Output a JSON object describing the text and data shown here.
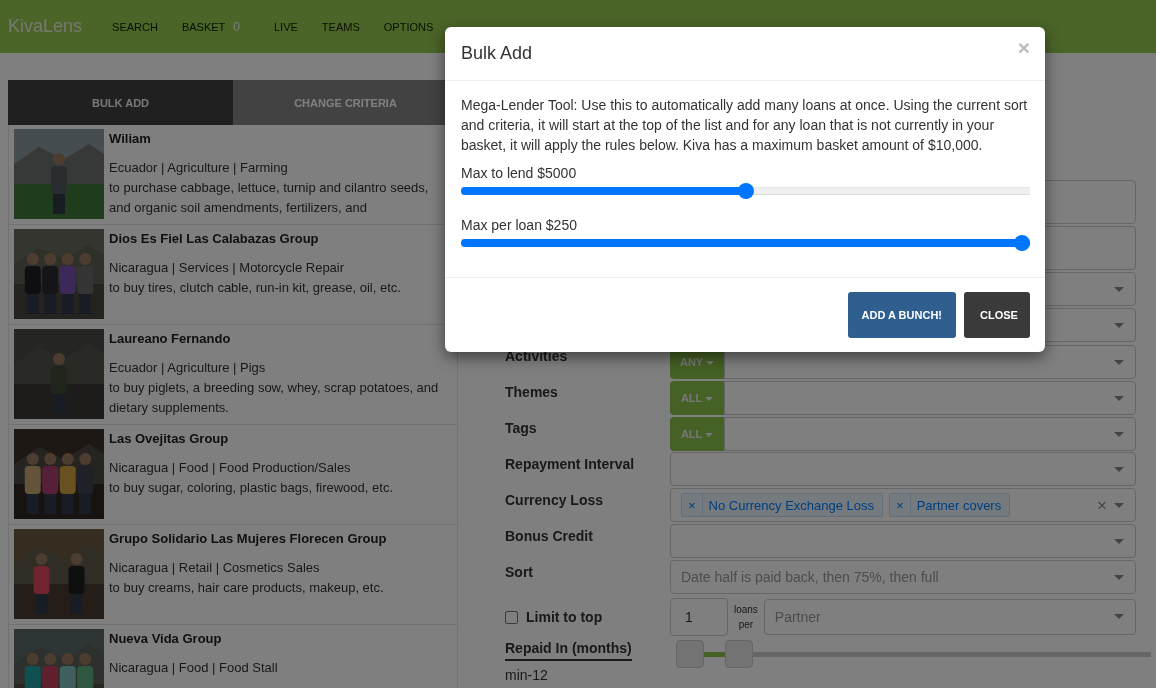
{
  "navbar": {
    "brand": "KivaLens",
    "items": [
      {
        "label": "SEARCH"
      },
      {
        "label": "BASKET",
        "badge": "0"
      },
      {
        "label": "LIVE"
      },
      {
        "label": "TEAMS"
      },
      {
        "label": "OPTIONS"
      }
    ]
  },
  "tabs": [
    {
      "label": "BULK ADD",
      "selected": true
    },
    {
      "label": "CHANGE CRITERIA",
      "selected": false
    }
  ],
  "loans": [
    {
      "name": "Wiliam",
      "meta": "Ecuador | Agriculture | Farming",
      "use": "to purchase cabbage, lettuce, turnip and cilantro seeds, and organic soil amendments, fertilizers, and",
      "kind": "picture"
    },
    {
      "name": "Dios Es Fiel Las Calabazas Group",
      "meta": "Nicaragua | Services | Motorcycle Repair",
      "use": "to buy tires, clutch cable, run-in kit, grease, oil, etc.",
      "kind": "picture"
    },
    {
      "name": "Laureano Fernando",
      "meta": "Ecuador | Agriculture | Pigs",
      "use": "to buy piglets, a breeding sow, whey, scrap potatoes, and dietary supplements.",
      "kind": "picture"
    },
    {
      "name": "Las Ovejitas Group",
      "meta": "Nicaragua | Food | Food Production/Sales",
      "use": "to buy sugar, coloring, plastic bags, firewood, etc.",
      "kind": "picture"
    },
    {
      "name": "Grupo Solidario Las Mujeres Florecen Group",
      "meta": "Nicaragua | Retail | Cosmetics Sales",
      "use": "to buy creams, hair care products, makeup, etc.",
      "kind": "picture"
    },
    {
      "name": "Nueva Vida Group",
      "meta": "Nicaragua | Food | Food Stall",
      "kind": "picture"
    }
  ],
  "criteria": [
    {
      "kind": "anyall",
      "label": "Activities",
      "mode": "ANY"
    },
    {
      "kind": "anyall",
      "label": "Themes",
      "mode": "ALL"
    },
    {
      "kind": "anyall",
      "label": "Tags",
      "mode": "ALL"
    },
    {
      "kind": "select",
      "label": "Repayment Interval"
    },
    {
      "kind": "tags",
      "label": "Currency Loss",
      "tags": [
        {
          "label": "No Currency Exchange Loss",
          "remove": "×"
        },
        {
          "label": "Partner covers",
          "remove": "×"
        }
      ],
      "clear": "×"
    },
    {
      "kind": "select",
      "label": "Bonus Credit"
    },
    {
      "kind": "select",
      "label": "Sort",
      "placeholder": "Date half is paid back, then 75%, then full"
    },
    {
      "kind": "limit",
      "label": "Limit to top",
      "checked": false,
      "value": "1",
      "unit": "loans per",
      "placeholder": "Partner"
    },
    {
      "kind": "range",
      "label": "Repaid In (months)",
      "reading": "min-12",
      "handles": [
        {
          "level": 0
        },
        {
          "level": 0.11
        }
      ]
    }
  ],
  "modal": {
    "title": "Bulk Add",
    "close": "×",
    "text": "Mega-Lender Tool: Use this to automatically add many loans at once. Using the current sort and criteria, it will start at the top of the list and for any loan that is not currently in your basket, it will apply the rules below. Kiva has a maximum basket amount of $10,000.",
    "sliders": [
      {
        "label": "Max to lend $5000",
        "level": 0.5
      },
      {
        "label": "Max per loan $250",
        "level": 1
      }
    ],
    "buttons": [
      {
        "label": "ADD A BUNCH!",
        "kind": "primary"
      },
      {
        "label": "CLOSE",
        "kind": "dark"
      }
    ]
  }
}
